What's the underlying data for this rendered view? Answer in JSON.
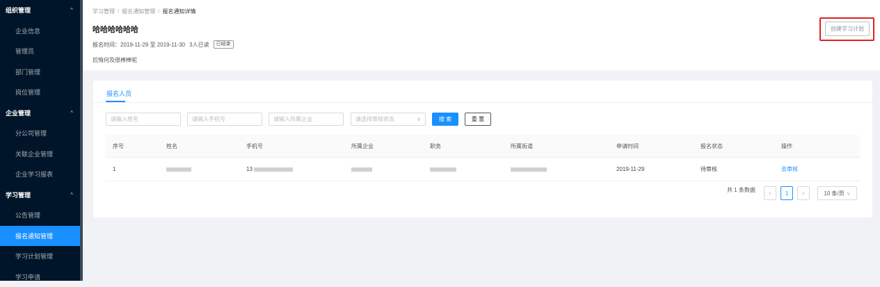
{
  "sidebar": {
    "groups": [
      {
        "label": "组织管理",
        "items": [
          "企业信息",
          "管理员",
          "部门管理",
          "岗位管理"
        ]
      },
      {
        "label": "企业管理",
        "items": [
          "分公司管理",
          "关联企业管理",
          "企业学习报表"
        ]
      },
      {
        "label": "学习管理",
        "items": [
          "公告管理",
          "报名通知管理",
          "学习计划管理",
          "学习申请"
        ]
      }
    ],
    "active": "报名通知管理"
  },
  "breadcrumb": [
    "学习管理",
    "报名通知管理",
    "报名通知详情"
  ],
  "title": "哈哈哈哈哈哈",
  "meta": {
    "time_label": "报名时间：",
    "start": "2019-11-29",
    "to": "至",
    "end": "2019-11-30",
    "read": "3人已读",
    "status_badge": "已结束"
  },
  "description": "后悔何及很棒棒呢",
  "create_button": "创建学习计划",
  "tab": "报名人员",
  "filters": {
    "name_placeholder": "请输入姓名",
    "phone_placeholder": "请输入手机号",
    "company_placeholder": "请输入所属企业",
    "status_placeholder": "请选择审核状态",
    "search": "搜 索",
    "reset": "重 置"
  },
  "table": {
    "columns": [
      "序号",
      "姓名",
      "手机号",
      "所属企业",
      "职务",
      "所属街道",
      "申请时间",
      "报名状态",
      "操作"
    ],
    "rows": [
      {
        "index": "1",
        "phone_prefix": "13",
        "apply_time": "2019-11-29",
        "status": "待审核",
        "action": "去审核"
      }
    ]
  },
  "pagination": {
    "total": "共 1 条数据",
    "prev": "<",
    "page": "1",
    "next": ">",
    "page_size": "10 条/页"
  },
  "colors": {
    "primary": "#1890ff",
    "sidebar_bg": "#001529",
    "highlight": "#e02020"
  }
}
